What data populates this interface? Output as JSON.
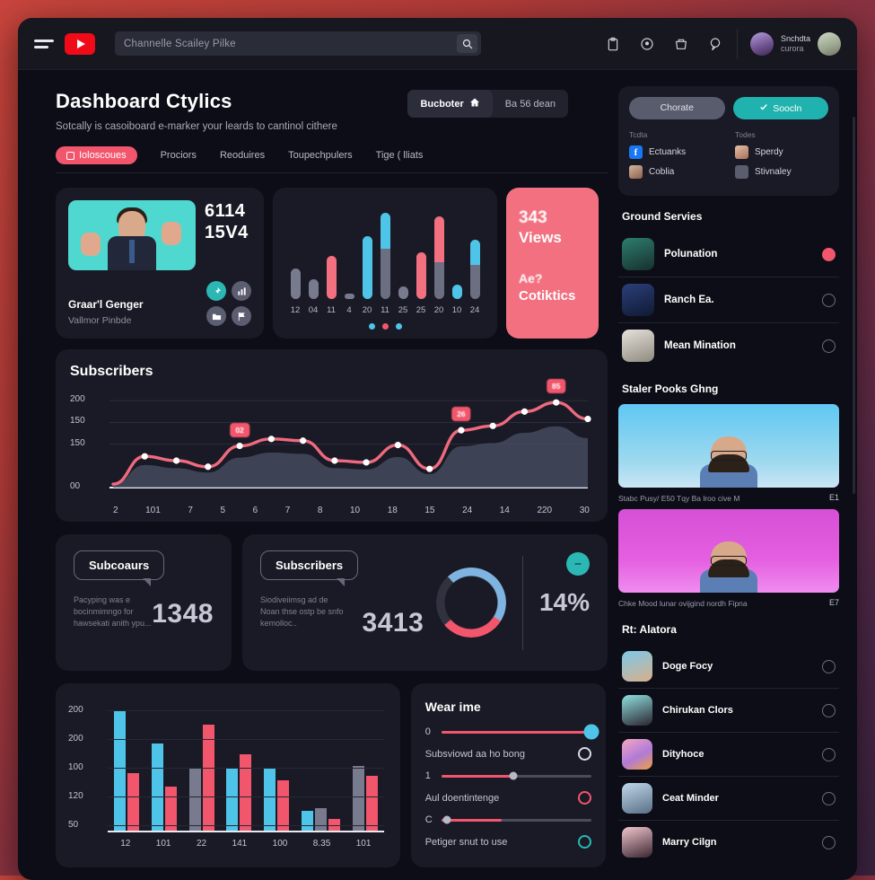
{
  "topbar": {
    "menu_icon": "hamburger-icon",
    "logo": "youtube-logo",
    "search_placeholder": "Channelle Scailey Pilke",
    "search_value": "",
    "search_button_icon": "search-icon",
    "icons": [
      "clipboard-icon",
      "info-circle-icon",
      "bag-icon",
      "comment-icon"
    ],
    "account_name": "Snchdta",
    "account_sub": "curora"
  },
  "header": {
    "title": "Dashboard Ctylics",
    "subtitle": "Sotcally is casoiboard e-marker your leards to cantinol cithere",
    "buttons": {
      "primary": "Bucboter",
      "primary_icon": "home-icon",
      "secondary": "Ba 56 dean"
    },
    "tabs": [
      {
        "label": "Ioloscoues",
        "active": true
      },
      {
        "label": "Prociors",
        "active": false
      },
      {
        "label": "Reoduires",
        "active": false
      },
      {
        "label": "Toupechpulers",
        "active": false
      },
      {
        "label": "Tige ( lliats",
        "active": false
      }
    ]
  },
  "hero": {
    "profile": {
      "stat_line1": "6114",
      "stat_line2": "15V4",
      "name": "Graar'l Genger",
      "handle": "Vallmor Pinbde",
      "actions": [
        "pin-icon",
        "chart-icon",
        "folder-icon",
        "flag-icon"
      ]
    },
    "bars": {
      "labels": [
        "12",
        "04",
        "11",
        "4",
        "20",
        "11",
        "25",
        "25",
        "20",
        "10",
        "24"
      ],
      "heights": [
        34,
        22,
        48,
        6,
        70,
        96,
        14,
        52,
        92,
        16,
        66
      ],
      "top_colors": [
        "#787b8e",
        "#787b8e",
        "#f2707f",
        "#787b8e",
        "#4ec5e8",
        "#4ec5e8",
        "#787b8e",
        "#f2707f",
        "#f2707f",
        "#4ec5e8",
        "#4ec5e8"
      ],
      "top_fractions": [
        1,
        1,
        1,
        1,
        1,
        0.42,
        1,
        1,
        0.55,
        1,
        0.42
      ],
      "base_color": "#6c6f82",
      "dots": 3
    },
    "views": {
      "number": "343",
      "label": "Views",
      "small1": "Ae?",
      "small2": "Cotiktics",
      "color": "#f2707f"
    }
  },
  "chart_data": [
    {
      "type": "line",
      "title": "Subscribers",
      "xlabel": "",
      "ylabel": "",
      "ylim": [
        0,
        200
      ],
      "grid": true,
      "ytick_labels": [
        "200",
        "150",
        "150",
        "00"
      ],
      "ytick_values": [
        200,
        150,
        100,
        0
      ],
      "x": [
        "2",
        "101",
        "7",
        "5",
        "6",
        "7",
        "8",
        "10",
        "18",
        "15",
        "24",
        "14",
        "220",
        "30"
      ],
      "values": [
        8,
        72,
        62,
        48,
        96,
        112,
        108,
        62,
        58,
        98,
        43,
        132,
        142,
        175,
        196,
        158
      ],
      "series": [
        {
          "name": "subscribers",
          "values": [
            8,
            72,
            62,
            48,
            96,
            112,
            108,
            62,
            58,
            98,
            43,
            132,
            142,
            175,
            196,
            158
          ]
        }
      ],
      "annotations": [
        {
          "label": "02",
          "index": 4
        },
        {
          "label": "26",
          "index": 11
        },
        {
          "label": "85",
          "index": 14
        }
      ],
      "line_color": "#ef6a7e",
      "area_color": "#4b5066"
    },
    {
      "type": "bar",
      "title": "",
      "grid": true,
      "ylim": [
        50,
        200
      ],
      "ytick_labels": [
        "200",
        "200",
        "100",
        "120",
        "50"
      ],
      "categories": [
        "12",
        "101",
        "22",
        "141",
        "100",
        "8.35",
        "101"
      ],
      "series": [
        {
          "name": "blue",
          "color": "#4ec5e8",
          "values": [
            185,
            135,
            null,
            95,
            95,
            30,
            null
          ]
        },
        {
          "name": "grey",
          "color": "#787b8e",
          "values": [
            null,
            null,
            95,
            null,
            null,
            35,
            100
          ]
        },
        {
          "name": "pink",
          "color": "#f2566d",
          "values": [
            88,
            68,
            163,
            118,
            78,
            18,
            85
          ]
        }
      ]
    },
    {
      "type": "pie",
      "title": "",
      "labels": [
        "blue",
        "pink",
        "track"
      ],
      "values": [
        40,
        30,
        30
      ],
      "colors": [
        "#7fb3e0",
        "#f2566d",
        "#31323f"
      ]
    }
  ],
  "stats": [
    {
      "bubble": "Subcoaurs",
      "description": "Pacyping was e bocinmimngo for hawsekati anith ypu...",
      "number": "1348"
    },
    {
      "bubble": "Subscribers",
      "description": "Siodiveiimsg ad de Noan thse ostp be snfo kemolloc..",
      "number": "3413",
      "percent": "14%",
      "fab_icon": "link-icon"
    }
  ],
  "settings": {
    "title": "Wear ime",
    "rows": [
      {
        "kind": "slider",
        "key": "0",
        "fill": 100,
        "knob": "big"
      },
      {
        "kind": "option",
        "label": "Subsviowd aa ho bong",
        "radio": "white"
      },
      {
        "kind": "slider",
        "key": "1",
        "fill": 48,
        "knob": "sm"
      },
      {
        "kind": "option",
        "label": "Aul doentintenge",
        "radio": "pink"
      },
      {
        "kind": "slider",
        "key": "C",
        "fill": 40,
        "knob": "sm",
        "knob_pos": 4
      },
      {
        "kind": "option",
        "label": "Petiger snut to use",
        "radio": "teal"
      }
    ]
  },
  "rail": {
    "buttons": {
      "left": "Chorate",
      "right": "Soocln",
      "right_icon": "check-icon"
    },
    "columns": [
      {
        "heading": "Tcdta",
        "items": [
          {
            "label": "Ectuanks",
            "icon": "facebook-icon"
          },
          {
            "label": "Coblia",
            "icon": "avatar-icon"
          }
        ]
      },
      {
        "heading": "Todes",
        "items": [
          {
            "label": "Sperdy",
            "icon": "avatar-icon"
          },
          {
            "label": "Stivnaley",
            "icon": "printer-icon"
          }
        ]
      }
    ],
    "services": {
      "title": "Ground Servies",
      "items": [
        {
          "name": "Polunation",
          "action": "record-icon",
          "live": true
        },
        {
          "name": "Ranch Ea.",
          "action": "clock-icon",
          "live": false
        },
        {
          "name": "Mean Mination",
          "action": "emoji-icon",
          "live": false
        }
      ]
    },
    "picks": {
      "title": "Staler Pooks Ghng",
      "videos": [
        {
          "caption": "Stabc Pusy/ E50 Tqy Ba lroo cive M",
          "time": "E1",
          "theme": "blue"
        },
        {
          "caption": "Chke Mood lunar ovijgind nordh Fipna",
          "time": "E7",
          "theme": "pink"
        }
      ]
    },
    "authors": {
      "title": "Rt: Alatora",
      "items": [
        {
          "name": "Doge Focy",
          "action": "eye-icon"
        },
        {
          "name": "Chirukan Clors",
          "action": "clock-icon"
        },
        {
          "name": "Dityhoce",
          "action": "cloud-icon"
        },
        {
          "name": "Ceat Minder",
          "action": "check-icon"
        },
        {
          "name": "Marry Cilgn",
          "action": "minus-icon"
        }
      ]
    }
  }
}
